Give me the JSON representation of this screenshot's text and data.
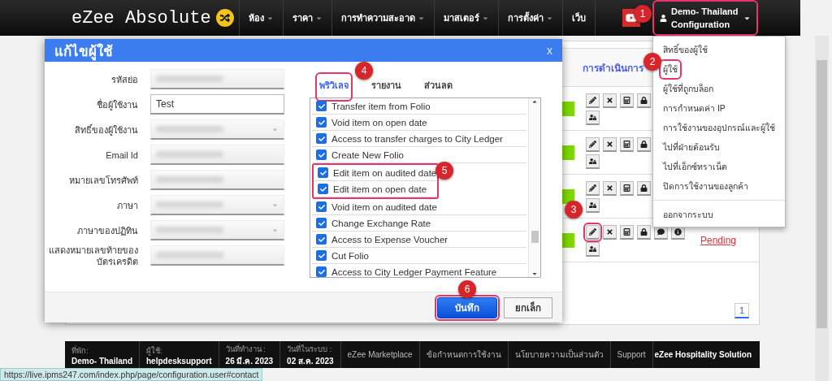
{
  "navbar": {
    "brand": "eZee Absolute",
    "menu": [
      {
        "label": "ห้อง",
        "dropdown": true
      },
      {
        "label": "ราคา",
        "dropdown": true
      },
      {
        "label": "การทำความสะอาด",
        "dropdown": true
      },
      {
        "label": "มาสเตอร์",
        "dropdown": true
      },
      {
        "label": "การตั้งค่า",
        "dropdown": true
      },
      {
        "label": "เว็บ",
        "dropdown": false
      }
    ],
    "user_menu": {
      "name": "Demo- Thailand",
      "section": "Configuration",
      "highlighted": true,
      "callout": "1"
    }
  },
  "user_dropdown": {
    "items": [
      {
        "label": "สิทธิ์ของผู้ใช้",
        "highlighted": false
      },
      {
        "label": "ผู้ใช้",
        "highlighted": true,
        "callout": "2"
      },
      {
        "label": "ผู้ใช้ที่ถูกบล็อก",
        "highlighted": false
      },
      {
        "label": "การกำหนดค่า IP",
        "highlighted": false
      },
      {
        "label": "การใช้งานของอุปกรณ์และผู้ใช้",
        "highlighted": false
      },
      {
        "label": "ไปที่ฝ่ายต้อนรับ",
        "highlighted": false
      },
      {
        "label": "ไปที่เอ็กซ์ทราเน็ต",
        "highlighted": false
      },
      {
        "label": "ปิดการใช้งานของลูกค้า",
        "highlighted": false
      }
    ],
    "logout": "ออกจากระบบ"
  },
  "user_table": {
    "actions_header": "การดำเนินการ",
    "rows": [
      {
        "actions": [
          {
            "kind": "edit",
            "highlighted": false
          },
          {
            "kind": "delete",
            "highlighted": false
          },
          {
            "kind": "device",
            "highlighted": false
          },
          {
            "kind": "lock",
            "highlighted": false
          }
        ],
        "more_actions": [
          {
            "kind": "user-lock",
            "highlighted": false
          }
        ]
      },
      {
        "actions": [
          {
            "kind": "edit",
            "highlighted": false
          },
          {
            "kind": "delete",
            "highlighted": false
          },
          {
            "kind": "device",
            "highlighted": false
          },
          {
            "kind": "lock",
            "highlighted": false
          }
        ],
        "more_actions": [
          {
            "kind": "user-lock",
            "highlighted": false
          }
        ]
      },
      {
        "actions": [
          {
            "kind": "edit",
            "highlighted": false
          },
          {
            "kind": "delete",
            "highlighted": false
          },
          {
            "kind": "device",
            "highlighted": false
          },
          {
            "kind": "lock",
            "highlighted": false
          }
        ],
        "more_actions": [
          {
            "kind": "user-lock",
            "highlighted": false
          }
        ]
      },
      {
        "actions": [
          {
            "kind": "edit",
            "highlighted": true,
            "callout": "3"
          },
          {
            "kind": "delete",
            "highlighted": false
          },
          {
            "kind": "device",
            "highlighted": false
          },
          {
            "kind": "lock",
            "highlighted": false
          },
          {
            "kind": "comment",
            "highlighted": false
          },
          {
            "kind": "info",
            "highlighted": false
          }
        ],
        "more_actions": [
          {
            "kind": "user-lock",
            "highlighted": false
          }
        ],
        "status": "Pending"
      }
    ],
    "pagination": [
      {
        "label": "1",
        "selected": true
      }
    ]
  },
  "modal": {
    "title": "แก้ไขผู้ใช้",
    "close": "x",
    "fields": [
      {
        "label": "รหัสย่อ",
        "kind": "text",
        "redacted": true
      },
      {
        "label": "ชื่อผู้ใช้งาน",
        "kind": "text",
        "redacted": false,
        "value": "Test"
      },
      {
        "label": "สิทธิ์ของผู้ใช้งาน",
        "kind": "select",
        "redacted": true
      },
      {
        "label": "Email Id",
        "kind": "text",
        "redacted": true
      },
      {
        "label": "หมายเลขโทรศัพท์",
        "kind": "text",
        "redacted": true
      },
      {
        "label": "ภาษา",
        "kind": "select",
        "redacted": true
      },
      {
        "label": "ภาษาของปฏิทิน",
        "kind": "select",
        "redacted": true
      },
      {
        "label": "แสดงหมายเลขท้ายของบัตรเครดิต",
        "kind": "text",
        "redacted": true
      }
    ],
    "tabs": [
      {
        "label": "พริวิเลจ",
        "selected": true,
        "highlighted": true,
        "callout": "4"
      },
      {
        "label": "รายงาน",
        "selected": false,
        "highlighted": false
      },
      {
        "label": "ส่วนลด",
        "selected": false,
        "highlighted": false
      }
    ],
    "privileges": [
      {
        "label": "Transfer item from Folio",
        "checked": true,
        "highlighted": false
      },
      {
        "label": "Void item on open date",
        "checked": true,
        "highlighted": false
      },
      {
        "label": "Access to transfer charges to City Ledger",
        "checked": true,
        "highlighted": false
      },
      {
        "label": "Create New Folio",
        "checked": true,
        "highlighted": false
      },
      {
        "label": "Edit item on audited date",
        "checked": true,
        "highlighted": true
      },
      {
        "label": "Edit item on open date",
        "checked": true,
        "highlighted": true,
        "callout": "5"
      },
      {
        "label": "Void item on audited date",
        "checked": true,
        "highlighted": false
      },
      {
        "label": "Change Exchange Rate",
        "checked": true,
        "highlighted": false
      },
      {
        "label": "Access to Expense Voucher",
        "checked": true,
        "highlighted": false
      },
      {
        "label": "Cut Folio",
        "checked": true,
        "highlighted": false
      },
      {
        "label": "Access to City Ledger Payment Feature",
        "checked": true,
        "highlighted": false
      }
    ],
    "buttons": [
      {
        "label": "บันทึก",
        "kind": "primary",
        "highlighted": true,
        "callout": "6"
      },
      {
        "label": "ยกเล็ก",
        "kind": "default",
        "highlighted": false
      }
    ]
  },
  "footer": {
    "cells": [
      {
        "label": "ที่พัก:",
        "value": "Demo- Thailand"
      },
      {
        "label": "ผู้ใช้:",
        "value": "helpdesksupport"
      },
      {
        "label": "วันที่ทำงาน :",
        "value": "26 มี.ค. 2023"
      },
      {
        "label": "วันที่ในระบบ :",
        "value": "02 ส.ค. 2023"
      }
    ],
    "links": [
      "eZee Marketplace",
      "ข้อกำหนดการใช้งาน",
      "นโยบายความเป็นส่วนตัว",
      "Support"
    ],
    "brand": "eZee Hospitality Solution"
  },
  "status_url": "https://live.ipms247.com/index.php/page/configuration.user#contact"
}
